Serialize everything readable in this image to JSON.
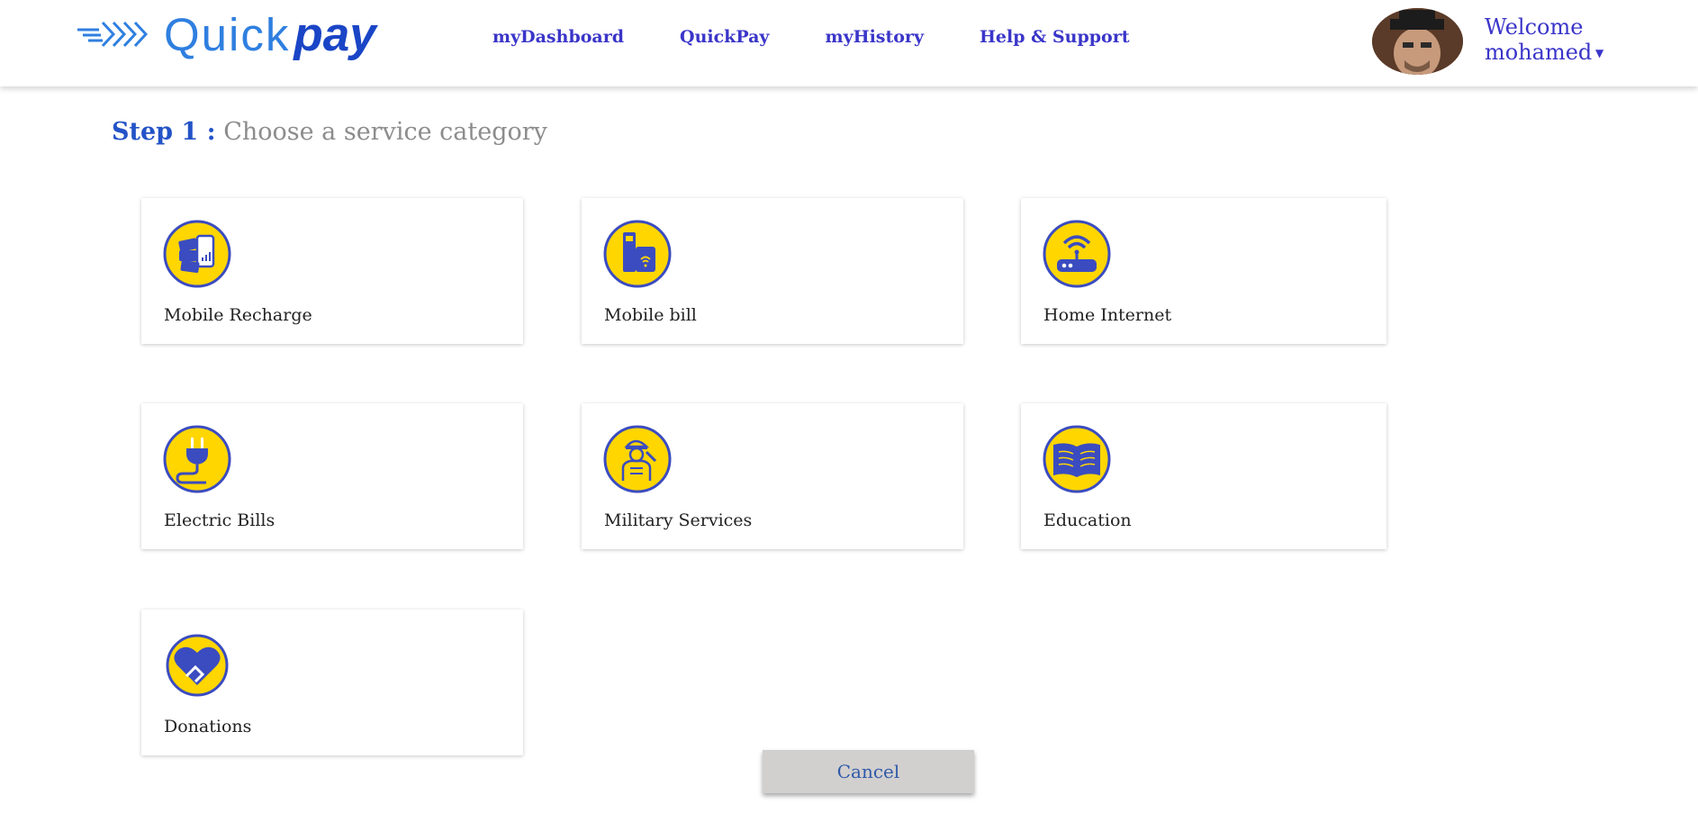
{
  "brand": {
    "quick": "Quick",
    "pay": "pay"
  },
  "nav": {
    "items": [
      {
        "label": "myDashboard"
      },
      {
        "label": "QuickPay"
      },
      {
        "label": "myHistory"
      },
      {
        "label": "Help & Support"
      }
    ]
  },
  "user": {
    "welcome": "Welcome",
    "name": "mohamed"
  },
  "step": {
    "label": "Step 1 :",
    "text": "Choose a service category"
  },
  "categories": [
    {
      "label": "Mobile Recharge",
      "icon": "mobile-recharge-icon"
    },
    {
      "label": "Mobile bill",
      "icon": "phone-bill-icon"
    },
    {
      "label": "Home Internet",
      "icon": "router-icon"
    },
    {
      "label": "Electric Bills",
      "icon": "plug-icon"
    },
    {
      "label": "Military Services",
      "icon": "soldier-icon"
    },
    {
      "label": "Education",
      "icon": "book-icon"
    },
    {
      "label": "Donations",
      "icon": "heart-handshake-icon"
    }
  ],
  "actions": {
    "cancel": "Cancel"
  },
  "colors": {
    "brand_blue": "#1a45c6",
    "nav_text": "#3a35c9",
    "icon_fill": "#ffd600",
    "icon_ring": "#3b4cc0",
    "cancel_bg": "#d2cfcf"
  }
}
